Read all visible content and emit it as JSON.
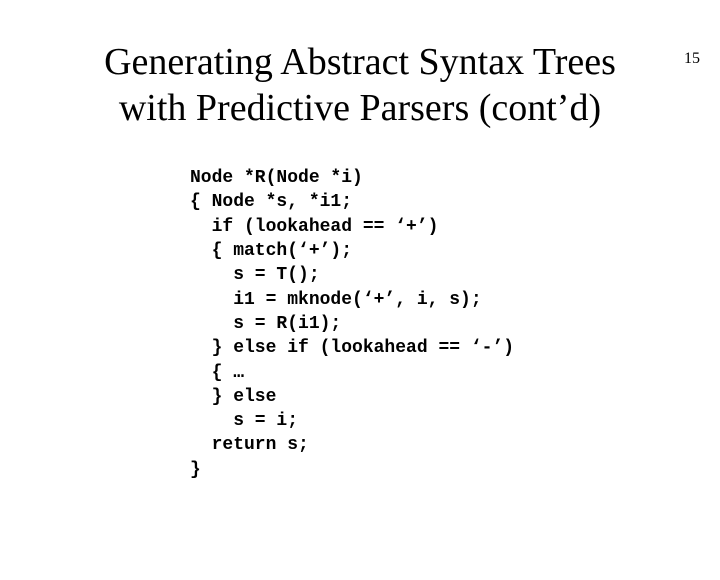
{
  "page_number": "15",
  "title_line1": "Generating Abstract Syntax Trees",
  "title_line2": "with Predictive Parsers (cont’d)",
  "code": {
    "l0": "Node *R(Node *i)",
    "l1": "{ Node *s, *i1;",
    "l2": "  if (lookahead == ‘+’)",
    "l3": "  { match(‘+’);",
    "l4": "    s = T();",
    "l5": "    i1 = mknode(‘+’, i, s);",
    "l6": "    s = R(i1);",
    "l7": "  } else if (lookahead == ‘-’)",
    "l8": "  { …",
    "l9": "  } else",
    "l10": "    s = i;",
    "l11": "  return s;",
    "l12": "}"
  }
}
